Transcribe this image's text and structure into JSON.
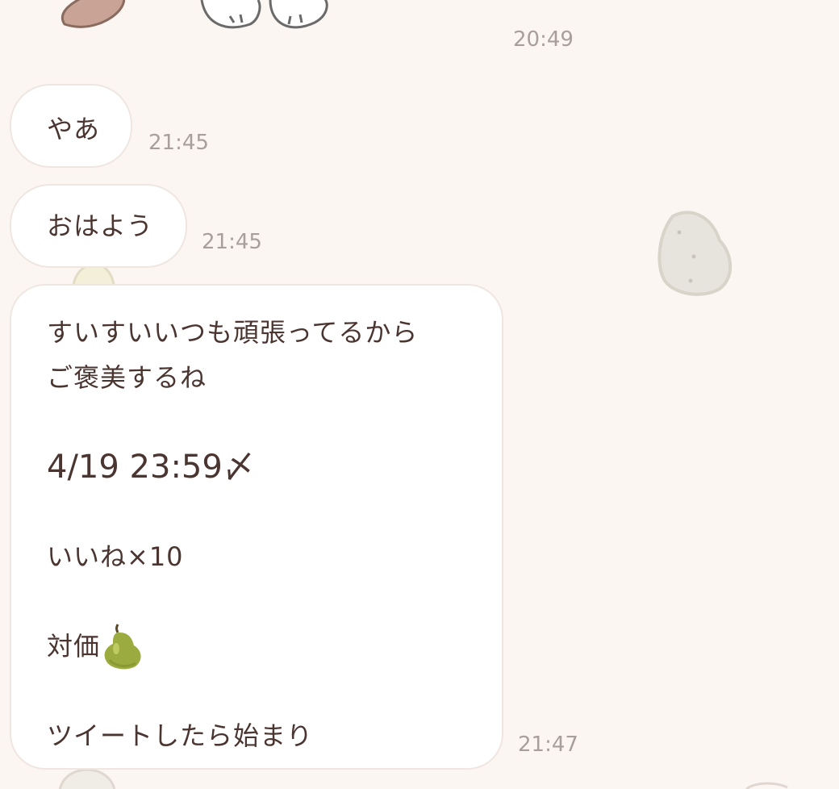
{
  "chat": {
    "messages": [
      {
        "timestamp": "20:49"
      },
      {
        "text": "やあ",
        "timestamp": "21:45"
      },
      {
        "text": "おはよう",
        "timestamp": "21:45"
      },
      {
        "lines": [
          "すいすいいつも頑張ってるから",
          "ご褒美するね",
          "4/19 23:59〆",
          "いいね×10",
          "対価",
          "ツイートしたら始まり"
        ],
        "emoji": "pear",
        "timestamp": "21:47"
      }
    ]
  },
  "colors": {
    "background": "#fcf6f3",
    "bubble": "#ffffff",
    "text": "#4a3530",
    "timestamp": "#a99f9a"
  }
}
